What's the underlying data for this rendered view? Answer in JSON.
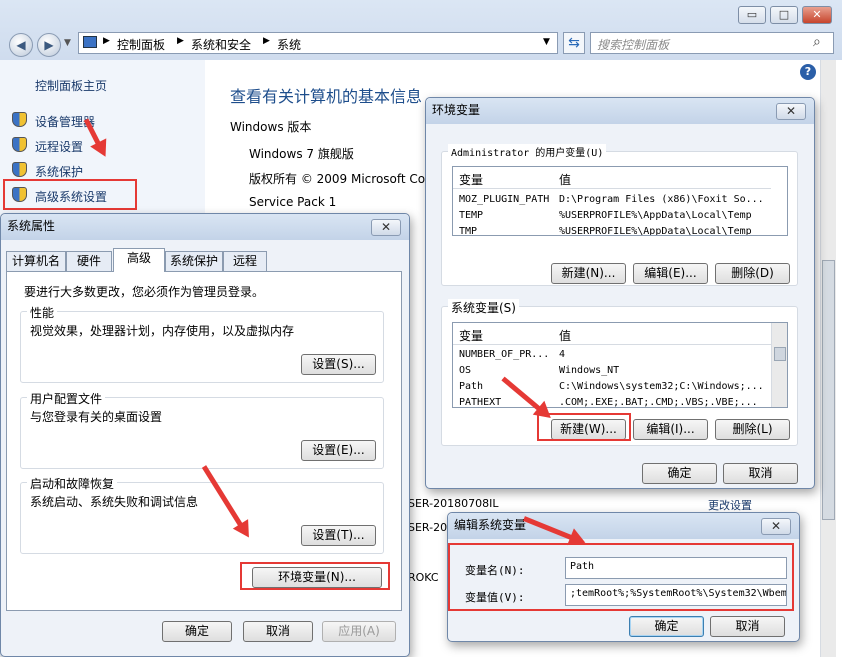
{
  "window": {
    "minimize": "▭",
    "maximize": "□",
    "close": "✕",
    "breadcrumb": [
      "控制面板",
      "系统和安全",
      "系统"
    ],
    "search_placeholder": "搜索控制面板",
    "help": "?"
  },
  "sidebar": {
    "home": "控制面板主页",
    "items": [
      {
        "label": "设备管理器",
        "icon": "shield-icon"
      },
      {
        "label": "远程设置",
        "icon": "shield-icon"
      },
      {
        "label": "系统保护",
        "icon": "shield-icon"
      },
      {
        "label": "高级系统设置",
        "icon": "shield-icon"
      }
    ]
  },
  "main": {
    "heading": "查看有关计算机的基本信息",
    "windows_edition_label": "Windows 版本",
    "edition": "Windows 7 旗舰版",
    "copyright": "版权所有 © 2009 Microsoft Co",
    "service_pack": "Service Pack 1",
    "partial_1": "SER-20180708IL",
    "partial_2": "SER-20",
    "partial_3": "ROKC",
    "change_settings": "更改设置"
  },
  "sysprops": {
    "title": "系统属性",
    "tabs": [
      "计算机名",
      "硬件",
      "高级",
      "系统保护",
      "远程"
    ],
    "admin_note": "要进行大多数更改，您必须作为管理员登录。",
    "performance": {
      "label": "性能",
      "desc": "视觉效果，处理器计划，内存使用，以及虚拟内存",
      "button": "设置(S)..."
    },
    "profiles": {
      "label": "用户配置文件",
      "desc": "与您登录有关的桌面设置",
      "button": "设置(E)..."
    },
    "startup": {
      "label": "启动和故障恢复",
      "desc": "系统启动、系统失败和调试信息",
      "button": "设置(T)..."
    },
    "env_button": "环境变量(N)...",
    "ok": "确定",
    "cancel": "取消",
    "apply": "应用(A)"
  },
  "envvars": {
    "title": "环境变量",
    "user_group": "Administrator 的用户变量(U)",
    "col_var": "变量",
    "col_val": "值",
    "user_vars": [
      {
        "name": "MOZ_PLUGIN_PATH",
        "value": "D:\\Program Files (x86)\\Foxit So..."
      },
      {
        "name": "TEMP",
        "value": "%USERPROFILE%\\AppData\\Local\\Temp"
      },
      {
        "name": "TMP",
        "value": "%USERPROFILE%\\AppData\\Local\\Temp"
      }
    ],
    "user_new": "新建(N)...",
    "user_edit": "编辑(E)...",
    "user_delete": "删除(D)",
    "sys_group": "系统变量(S)",
    "sys_vars": [
      {
        "name": "NUMBER_OF_PR...",
        "value": "4"
      },
      {
        "name": "OS",
        "value": "Windows_NT"
      },
      {
        "name": "Path",
        "value": "C:\\Windows\\system32;C:\\Windows;..."
      },
      {
        "name": "PATHEXT",
        "value": ".COM;.EXE;.BAT;.CMD;.VBS;.VBE;..."
      }
    ],
    "sys_new": "新建(W)...",
    "sys_edit": "编辑(I)...",
    "sys_delete": "删除(L)",
    "ok": "确定",
    "cancel": "取消"
  },
  "editvar": {
    "title": "编辑系统变量",
    "name_label": "变量名(N):",
    "name_value": "Path",
    "value_label": "变量值(V):",
    "value_value": ";temRoot%;%SystemRoot%\\System32\\Wbem",
    "ok": "确定",
    "cancel": "取消"
  },
  "colors": {
    "highlight": "#e53935",
    "link": "#1a3a6b",
    "heading": "#1e4e8c"
  }
}
